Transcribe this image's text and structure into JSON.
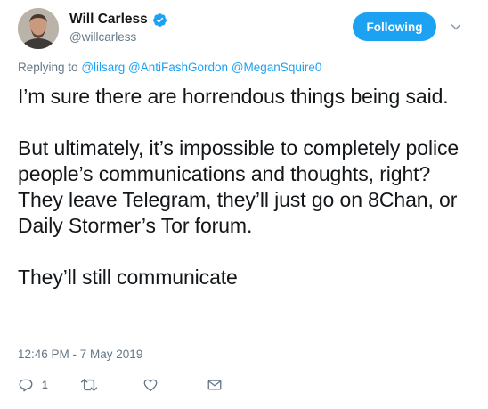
{
  "author": {
    "name": "Will Carless",
    "handle": "@willcarless",
    "verified_icon": "verified-badge-icon",
    "avatar_icon": "avatar-photo"
  },
  "follow_button": {
    "label": "Following",
    "color": "#1da1f2"
  },
  "replying": {
    "prefix": "Replying to",
    "mentions": [
      "@lilsarg",
      "@AntiFashGordon",
      "@MeganSquire0"
    ]
  },
  "body": {
    "paragraphs": [
      "I’m sure there are horrendous things being said.",
      "But ultimately, it’s impossible to completely police people’s communications and thoughts, right? They leave Telegram, they’ll just go on 8Chan, or Daily Stormer’s Tor forum.",
      "They’ll still communicate"
    ]
  },
  "timestamp": "12:46 PM - 7 May 2019",
  "actions": {
    "reply_count": "1",
    "icons": [
      "reply-icon",
      "retweet-icon",
      "like-icon",
      "message-icon"
    ]
  },
  "colors": {
    "text": "#14171a",
    "secondary": "#657786",
    "accent": "#1da1f2"
  }
}
